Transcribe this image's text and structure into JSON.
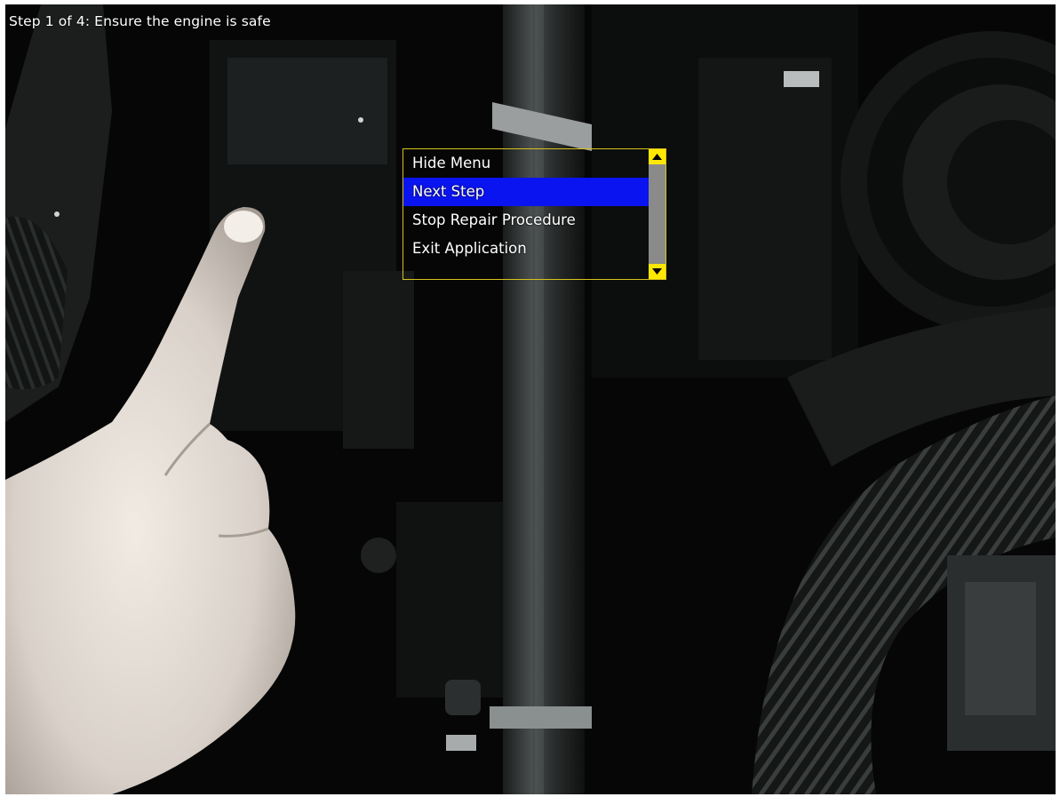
{
  "step": {
    "label": "Step 1 of 4: Ensure the engine is safe"
  },
  "menu": {
    "items": [
      {
        "label": "Hide Menu",
        "selected": false
      },
      {
        "label": "Next Step",
        "selected": true
      },
      {
        "label": "Stop Repair Procedure",
        "selected": false
      },
      {
        "label": "Exit Application",
        "selected": false
      }
    ],
    "scroll_up_icon": "triangle-up-icon",
    "scroll_down_icon": "triangle-down-icon"
  },
  "colors": {
    "highlight": "#0a14f0",
    "menu_border": "#d6c31a",
    "scroll_button": "#ffe800",
    "scroll_track": "#8a8a8a"
  }
}
